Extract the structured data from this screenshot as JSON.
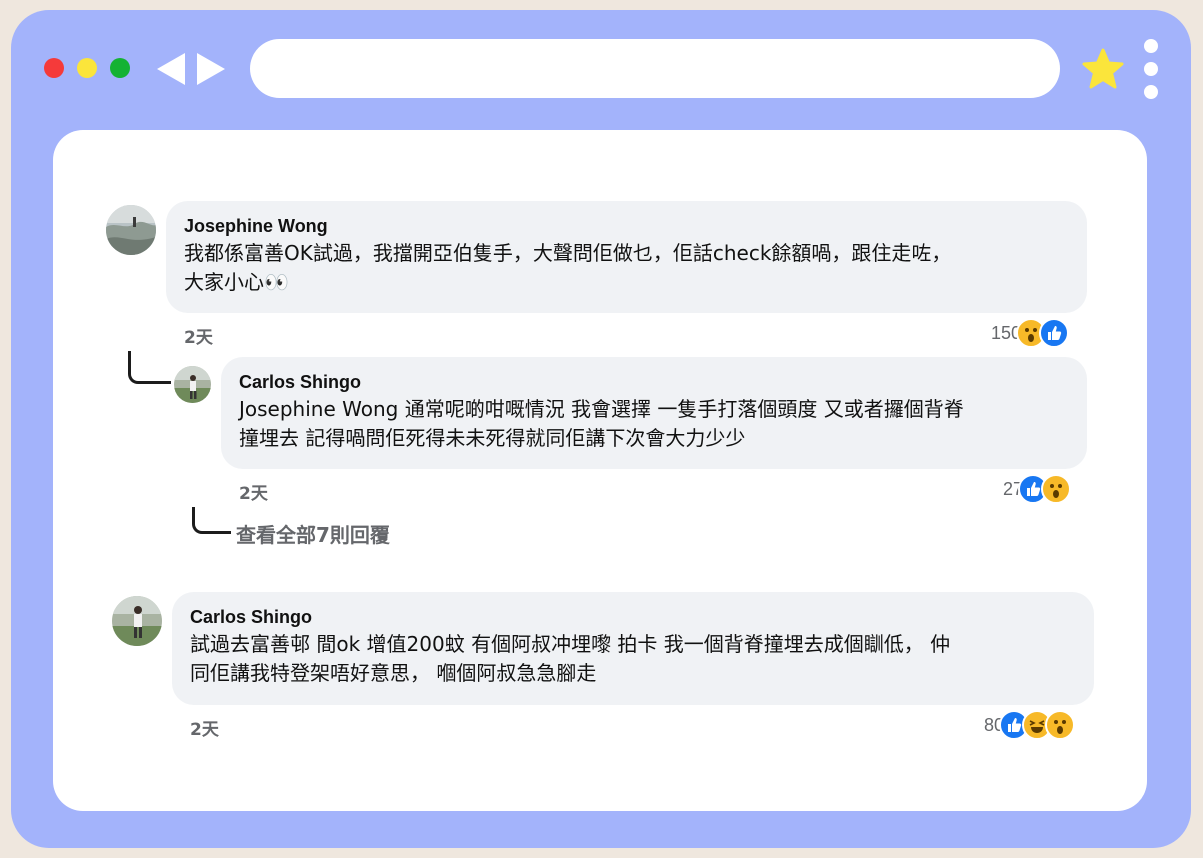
{
  "browser": {
    "back_icon": "back-arrow-icon",
    "forward_icon": "forward-arrow-icon",
    "url_value": "",
    "star_icon": "star-icon",
    "menu_icon": "kebab-menu-icon"
  },
  "colors": {
    "frame": "#a3b3fb",
    "page_bg": "#efe7de",
    "bubble": "#f0f2f5",
    "like_blue": "#1877f2",
    "wow_yellow": "#f7b928"
  },
  "comments": [
    {
      "author": "Josephine Wong",
      "line1": "我都係富善OK試過，我擋開亞伯隻手，大聲問佢做乜，佢話check餘額喎，跟住走咗，",
      "line2": "大家小心👀",
      "time": "2天",
      "reaction_count": "150",
      "reactions": [
        "wow",
        "like"
      ]
    },
    {
      "author": "Carlos Shingo",
      "line1": "Josephine Wong 通常呢啲咁嘅情況 我會選擇 一隻手打落個頭度 又或者攞個背脊",
      "line2": "撞埋去 記得喎問佢死得未未死得就同佢講下次會大力少少",
      "time": "2天",
      "reaction_count": "27",
      "reactions": [
        "like",
        "wow"
      ]
    },
    {
      "author": "Carlos Shingo",
      "line1": "試過去富善邨 間ok 增值200蚊 有個阿叔冲埋嚟 拍卡 我一個背脊撞埋去成個瞓低， 仲",
      "line2": "同佢講我特登架唔好意思， 嗰個阿叔急急腳走",
      "time": "2天",
      "reaction_count": "80",
      "reactions": [
        "like",
        "haha",
        "wow"
      ]
    }
  ],
  "view_more_replies": "查看全部7則回覆"
}
